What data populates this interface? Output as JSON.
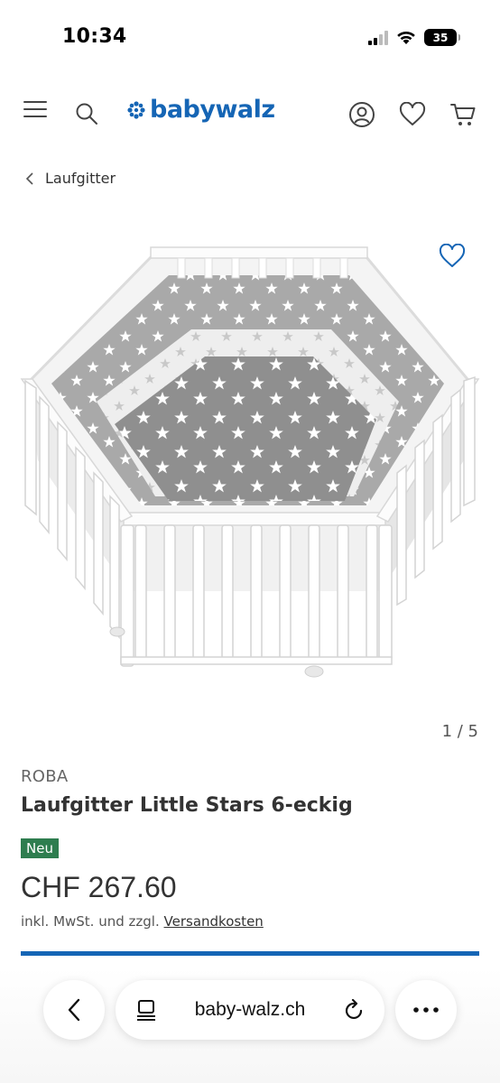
{
  "status": {
    "time": "10:34",
    "battery": "35"
  },
  "header": {
    "logo_text": "babywalz",
    "brand_color": "#1565b5",
    "icons": [
      "menu-icon",
      "search-icon",
      "user-icon",
      "heart-icon",
      "cart-icon"
    ]
  },
  "breadcrumb": {
    "label": "Laufgitter"
  },
  "gallery": {
    "counter": "1 / 5"
  },
  "product": {
    "brand": "ROBA",
    "title": "Laufgitter Little Stars 6-eckig",
    "badge": "Neu",
    "badge_color": "#2e7d4f",
    "price": "CHF 267.60",
    "tax_prefix": "inkl. MwSt. und zzgl.",
    "tax_link": "Versandkosten"
  },
  "browser": {
    "url": "baby-walz.ch"
  }
}
